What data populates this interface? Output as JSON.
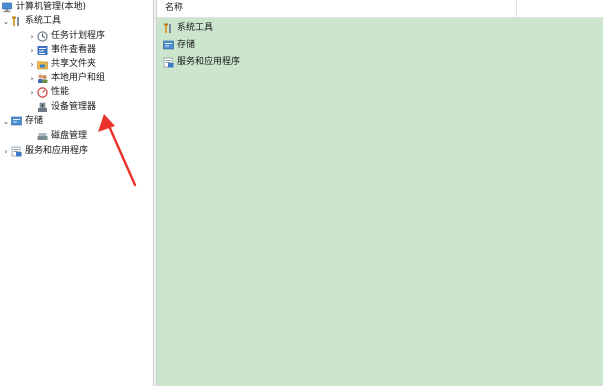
{
  "tree": {
    "root": {
      "label": "计算机管理(本地)",
      "icon": "computer-management-icon"
    },
    "system_tools": {
      "label": "系统工具",
      "expander": "expanded",
      "icon": "tools-icon",
      "children": [
        {
          "label": "任务计划程序",
          "icon": "clock-icon",
          "expander": "collapsed"
        },
        {
          "label": "事件查看器",
          "icon": "event-viewer-icon",
          "expander": "collapsed"
        },
        {
          "label": "共享文件夹",
          "icon": "shared-folder-icon",
          "expander": "collapsed"
        },
        {
          "label": "本地用户和组",
          "icon": "users-icon",
          "expander": "collapsed"
        },
        {
          "label": "性能",
          "icon": "performance-icon",
          "expander": "collapsed"
        },
        {
          "label": "设备管理器",
          "icon": "device-manager-icon",
          "expander": "none"
        }
      ]
    },
    "storage": {
      "label": "存储",
      "expander": "expanded",
      "icon": "storage-icon",
      "children": [
        {
          "label": "磁盘管理",
          "icon": "disk-icon",
          "expander": "none"
        }
      ]
    },
    "services": {
      "label": "服务和应用程序",
      "expander": "collapsed",
      "icon": "services-icon"
    }
  },
  "list": {
    "column_header": "名称",
    "items": [
      {
        "label": "系统工具",
        "icon": "tools-icon"
      },
      {
        "label": "存储",
        "icon": "storage-icon"
      },
      {
        "label": "服务和应用程序",
        "icon": "services-icon"
      }
    ]
  },
  "colors": {
    "content_background": "#cbe6cd",
    "annotation_arrow": "#e8322a"
  }
}
